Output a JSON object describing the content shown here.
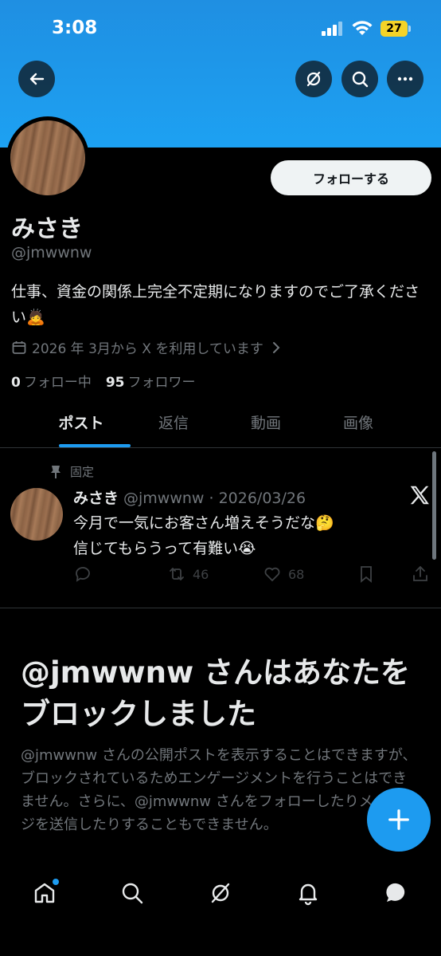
{
  "status_bar": {
    "time": "3:08",
    "battery": "27"
  },
  "profile": {
    "follow_label": "フォローする",
    "name": "みさき",
    "handle": "@jmwwnw",
    "bio": "仕事、資金の関係上完全不定期になりますのでご了承ください🙇",
    "joined": "2026 年 3月から X を利用しています",
    "following_count": "0",
    "following_label": "フォロー中",
    "followers_count": "95",
    "followers_label": "フォロワー"
  },
  "tabs": [
    {
      "label": "ポスト",
      "active": true
    },
    {
      "label": "返信",
      "active": false
    },
    {
      "label": "動画",
      "active": false
    },
    {
      "label": "画像",
      "active": false
    }
  ],
  "pinned_post": {
    "pinned_label": "固定",
    "author": "みさき",
    "meta": "@jmwwnw · 2026/03/26",
    "line1": "今月で一気にお客さん増えそうだな🤔",
    "line2": "信じてもらうって有難い😭",
    "retweets": "46",
    "likes": "68"
  },
  "block_notice": {
    "title": "@jmwwnw さんはあなたをブロックしました",
    "description": "@jmwwnw さんの公開ポストを表示することはできますが、ブロックされているためエンゲージメントを行うことはできません。さらに、@jmwwnw さんをフォローしたりメッセージを送信したりすることもできません。"
  },
  "colors": {
    "accent": "#1d9bf0",
    "banner": "#1da1f2",
    "muted": "#71767b"
  }
}
